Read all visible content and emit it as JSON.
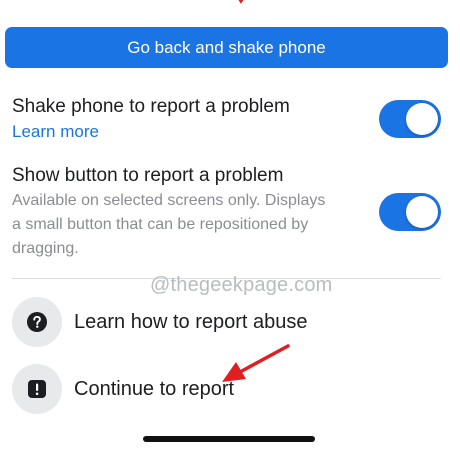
{
  "shake_button_label": "Go back and shake phone",
  "settings": [
    {
      "title": "Shake phone to report a problem",
      "link": "Learn more",
      "enabled": true
    },
    {
      "title": "Show button to report a problem",
      "description": "Available on selected screens only. Displays a small button that can be repositioned by dragging.",
      "enabled": true
    }
  ],
  "watermark": "@thegeekpage.com",
  "menu": [
    {
      "label": "Learn how to report abuse",
      "icon": "question-mark-icon"
    },
    {
      "label": "Continue to report",
      "icon": "exclamation-icon"
    }
  ],
  "colors": {
    "accent": "#1b74e4",
    "annotation_arrow": "#e02020",
    "icon_background": "#e8e9eb"
  }
}
